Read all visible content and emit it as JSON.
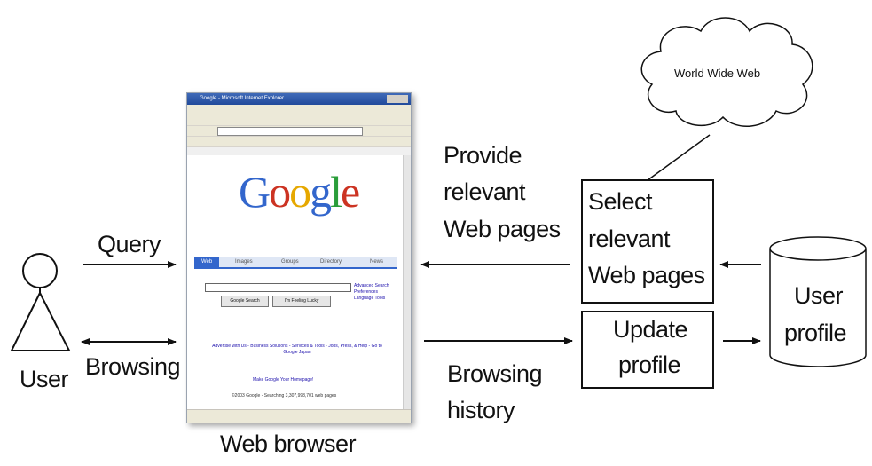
{
  "labels": {
    "user": "User",
    "query": "Query",
    "browsing": "Browsing",
    "web_browser": "Web browser",
    "provide": [
      "Provide",
      "relevant",
      "Web pages"
    ],
    "browsing_history": [
      "Browsing",
      "history"
    ],
    "select_box": [
      "Select",
      "relevant",
      "Web pages"
    ],
    "update_box": [
      "Update",
      "profile"
    ],
    "user_profile": [
      "User",
      "profile"
    ],
    "www": "World Wide Web"
  },
  "browser": {
    "title": "Google - Microsoft Internet Explorer",
    "logo": "Google",
    "tabs": [
      "Web",
      "Images",
      "Groups",
      "Directory",
      "News"
    ],
    "buttons": [
      "Google Search",
      "I'm Feeling Lucky"
    ],
    "side_links": [
      "Advanced Search",
      "Preferences",
      "Language Tools"
    ],
    "footer_links": "Advertise with Us - Business Solutions - Services & Tools - Jobs, Press, & Help - Go to Google Japan",
    "make_homepage": "Make Google Your Homepage!",
    "copyright": "©2003 Google - Searching 3,307,998,701 web pages"
  }
}
